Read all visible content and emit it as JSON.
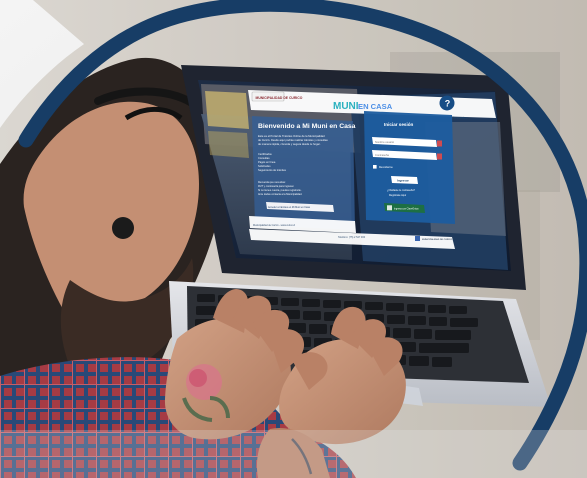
{
  "screen": {
    "municipality_name": "MUNICIPALIDAD DE CURICO",
    "brand_name": "MUNI",
    "brand_suffix": "EN CASA",
    "help_label": "Preguntas Frecuentes",
    "help_icon": "question-mark-icon",
    "welcome_title": "Bienvenido a Mi Muni en Casa",
    "intro_text": [
      "Este es el Portal de Trámites Online de la Municipalidad",
      "de Curicó. Desde aquí podrás realizar trámites y consultas",
      "de manera rápida, cómoda y segura desde tu hogar."
    ],
    "services_text": [
      "Certificados",
      "Consultas",
      "Pagos en línea",
      "Solicitudes",
      "Seguimiento de trámites"
    ],
    "info_text": [
      "Recuerda que necesitas:",
      "RUT y contraseña para ingresar.",
      "Si no tienes cuenta, puedes registrarte.",
      "Ante dudas contacta a la Municipalidad."
    ],
    "left_button_label": "Acceder a trámites en Mi Muni en Casa",
    "left_footer_text": "Municipalidad de Curicó - www.curico.cl",
    "login_title": "Iniciar sesión",
    "username_placeholder": "Nombre usuario",
    "password_placeholder": "Contraseña",
    "remember_label": "Recordarme",
    "login_button": "Ingresar",
    "forgot_password": "¿Olvidaste tu contraseña?",
    "register_link": "Regístrate Aquí",
    "clave_unica_label": "Ingresa con ClaveÚnica",
    "footer_contact": "Teléfono: (75) 2 547 000",
    "footer_brand": "MUNICIPALIDAD DE CURICO",
    "footer_icon": "facebook-icon"
  },
  "colors": {
    "frame_ring": "#173d66",
    "brand_teal": "#28a8b6",
    "panel_white": "#ffffff",
    "panel_blue": "#1f5f9d",
    "accent_red": "#c1383d",
    "shirt_red": "#a83b43",
    "shirt_blue": "#274c86",
    "skin": "#c08b70"
  }
}
